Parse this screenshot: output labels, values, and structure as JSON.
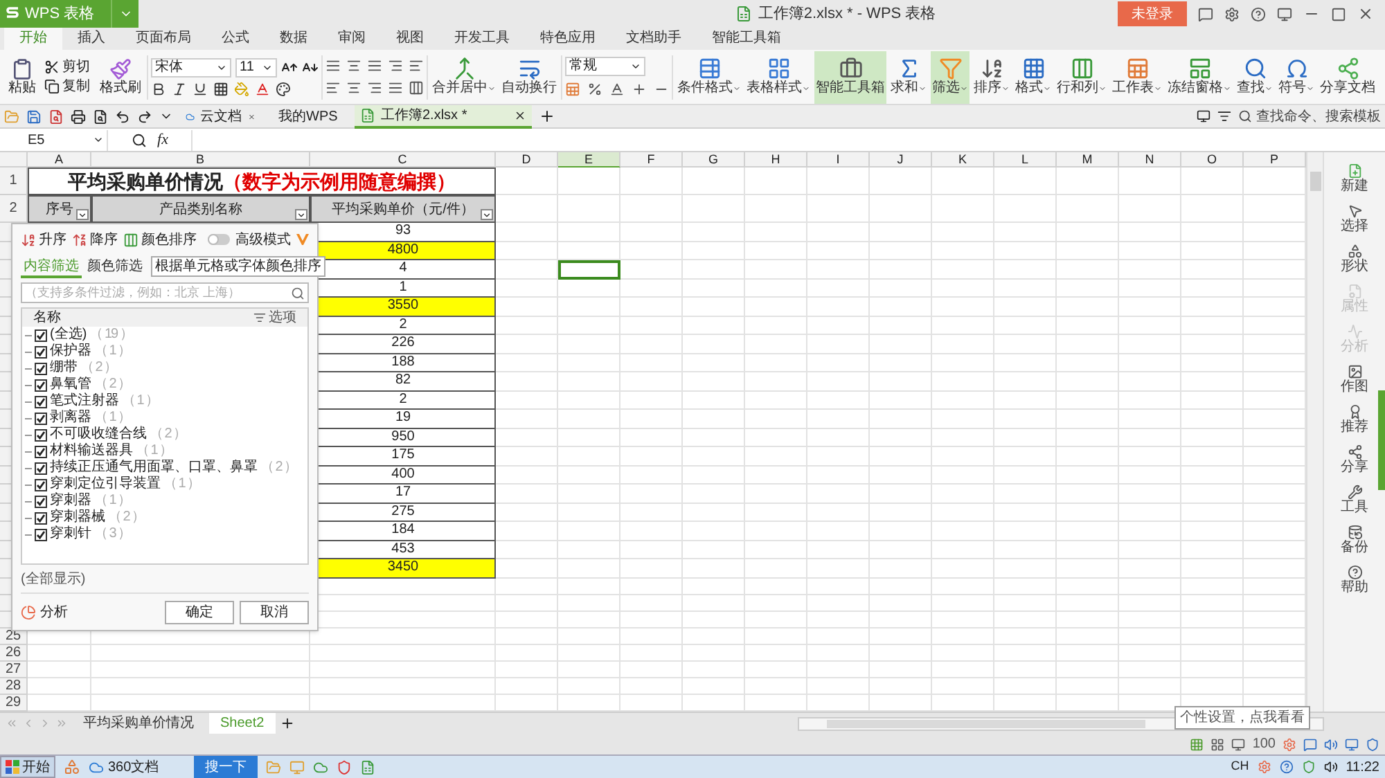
{
  "title_bar": {
    "app_button": "WPS 表格",
    "title": "工作簿2.xlsx * - WPS 表格",
    "login_button": "未登录"
  },
  "menu_tabs": [
    {
      "label": "开始",
      "selected": true
    },
    {
      "label": "插入",
      "selected": false
    },
    {
      "label": "页面布局",
      "selected": false
    },
    {
      "label": "公式",
      "selected": false
    },
    {
      "label": "数据",
      "selected": false
    },
    {
      "label": "审阅",
      "selected": false
    },
    {
      "label": "视图",
      "selected": false
    },
    {
      "label": "开发工具",
      "selected": false
    },
    {
      "label": "特色应用",
      "selected": false
    },
    {
      "label": "文档助手",
      "selected": false
    },
    {
      "label": "智能工具箱",
      "selected": false
    }
  ],
  "ribbon": {
    "paste": "粘贴",
    "cut": "剪切",
    "copy": "复制",
    "format_painter": "格式刷",
    "font_name": "宋体",
    "font_size": "11",
    "number_format": "常规",
    "align_tools": [
      {
        "kind": "merge",
        "label": "合并居中",
        "dropdown": true,
        "highlighted": false
      },
      {
        "kind": "wrap",
        "label": "自动换行",
        "dropdown": false,
        "highlighted": false
      }
    ],
    "tools": [
      {
        "kind": "conditional",
        "label": "条件格式",
        "dropdown": true,
        "highlighted": false
      },
      {
        "kind": "table_style",
        "label": "表格样式",
        "dropdown": true,
        "highlighted": false
      },
      {
        "kind": "toolbox",
        "label": "智能工具箱",
        "dropdown": false,
        "highlighted": true
      },
      {
        "kind": "sum",
        "label": "求和",
        "dropdown": true,
        "highlighted": false
      },
      {
        "kind": "filter",
        "label": "筛选",
        "dropdown": true,
        "highlighted": true
      },
      {
        "kind": "sort",
        "label": "排序",
        "dropdown": true,
        "highlighted": false
      },
      {
        "kind": "format",
        "label": "格式",
        "dropdown": true,
        "highlighted": false
      },
      {
        "kind": "rows_cols",
        "label": "行和列",
        "dropdown": true,
        "highlighted": false
      },
      {
        "kind": "sheet",
        "label": "工作表",
        "dropdown": true,
        "highlighted": false
      },
      {
        "kind": "freeze",
        "label": "冻结窗格",
        "dropdown": true,
        "highlighted": false
      },
      {
        "kind": "find",
        "label": "查找",
        "dropdown": true,
        "highlighted": false
      },
      {
        "kind": "symbol",
        "label": "符号",
        "dropdown": true,
        "highlighted": false
      },
      {
        "kind": "share",
        "label": "分享文档",
        "dropdown": false,
        "highlighted": false
      }
    ]
  },
  "doc_tabs": [
    {
      "kind": "cloud",
      "label": "云文档",
      "selected": false
    },
    {
      "kind": "wps",
      "label": "我的WPS",
      "selected": false
    },
    {
      "kind": "sheet",
      "label": "工作簿2.xlsx *",
      "selected": true
    }
  ],
  "command_search": "查找命令、搜索模板",
  "formula_bar": {
    "name_box": "E5",
    "fx_label": "fx"
  },
  "columns": [
    {
      "label": "A",
      "selected": false
    },
    {
      "label": "B",
      "selected": false
    },
    {
      "label": "C",
      "selected": false
    },
    {
      "label": "D",
      "selected": false
    },
    {
      "label": "E",
      "selected": true
    },
    {
      "label": "F",
      "selected": false
    },
    {
      "label": "G",
      "selected": false
    },
    {
      "label": "H",
      "selected": false
    },
    {
      "label": "I",
      "selected": false
    },
    {
      "label": "J",
      "selected": false
    },
    {
      "label": "K",
      "selected": false
    },
    {
      "label": "L",
      "selected": false
    },
    {
      "label": "M",
      "selected": false
    },
    {
      "label": "N",
      "selected": false
    },
    {
      "label": "O",
      "selected": false
    },
    {
      "label": "P",
      "selected": false
    }
  ],
  "table": {
    "title_row_number": "1",
    "title": "平均采购单价情况",
    "title_note": "（数字为示例用随意编撰）",
    "header_row_number": "2",
    "headers": [
      "序号",
      "产品类别名称",
      "平均采购单价（元/件）"
    ],
    "rows": [
      {
        "value": "93",
        "highlight": false,
        "selected": false
      },
      {
        "value": "4800",
        "highlight": true,
        "selected": false
      },
      {
        "value": "4",
        "highlight": false,
        "selected": true
      },
      {
        "value": "1",
        "highlight": false,
        "selected": false
      },
      {
        "value": "3550",
        "highlight": true,
        "selected": false
      },
      {
        "value": "2",
        "highlight": false,
        "selected": false
      },
      {
        "value": "226",
        "highlight": false,
        "selected": false
      },
      {
        "value": "188",
        "highlight": false,
        "selected": false
      },
      {
        "value": "82",
        "highlight": false,
        "selected": false
      },
      {
        "value": "2",
        "highlight": false,
        "selected": false
      },
      {
        "value": "19",
        "highlight": false,
        "selected": false
      },
      {
        "value": "950",
        "highlight": false,
        "selected": false
      },
      {
        "value": "175",
        "highlight": false,
        "selected": false
      },
      {
        "value": "400",
        "highlight": false,
        "selected": false
      },
      {
        "value": "17",
        "highlight": false,
        "selected": false
      },
      {
        "value": "275",
        "highlight": false,
        "selected": false
      },
      {
        "value": "184",
        "highlight": false,
        "selected": false
      },
      {
        "value": "453",
        "highlight": false,
        "selected": false
      },
      {
        "value": "3450",
        "highlight": true,
        "selected": false
      }
    ],
    "empty_rows": [
      {},
      {},
      {},
      {
        "number": "25"
      },
      {
        "number": "26"
      },
      {
        "number": "27"
      },
      {
        "number": "28"
      },
      {
        "number": "29"
      }
    ]
  },
  "filter_panel": {
    "sort_ascending": "升序",
    "sort_descending": "降序",
    "color_sort": "颜色排序",
    "advanced_mode": {
      "label": "高级模式",
      "on": false
    },
    "tabs": [
      {
        "label": "内容筛选",
        "selected": true
      },
      {
        "label": "颜色筛选",
        "selected": false
      }
    ],
    "color_sort_button": "根据单元格或字体颜色排序",
    "search_placeholder": "（支持多条件过滤，例如：北京 上海）",
    "list_header": "名称",
    "options_button": "选项",
    "items": [
      {
        "label": "(全选)",
        "count": "（ 19 ）",
        "checked": true
      },
      {
        "label": "保护器",
        "count": "（ 1 ）",
        "checked": true
      },
      {
        "label": "绷带",
        "count": "（ 2 ）",
        "checked": true
      },
      {
        "label": "鼻氧管",
        "count": "（ 2 ）",
        "checked": true
      },
      {
        "label": "笔式注射器",
        "count": "（ 1 ）",
        "checked": true
      },
      {
        "label": "剥离器",
        "count": "（ 1 ）",
        "checked": true
      },
      {
        "label": "不可吸收缝合线",
        "count": "（ 2 ）",
        "checked": true
      },
      {
        "label": "材料输送器具",
        "count": "（ 1 ）",
        "checked": true
      },
      {
        "label": "持续正压通气用面罩、口罩、鼻罩",
        "count": "（ 2 ）",
        "checked": true
      },
      {
        "label": "穿刺定位引导装置",
        "count": "（ 1 ）",
        "checked": true
      },
      {
        "label": "穿刺器",
        "count": "（ 1 ）",
        "checked": true
      },
      {
        "label": "穿刺器械",
        "count": "（ 2 ）",
        "checked": true
      },
      {
        "label": "穿刺针",
        "count": "（ 3 ）",
        "checked": true
      }
    ],
    "show_all": "(全部显示)",
    "analyze": "分析",
    "ok_button": "确定",
    "cancel_button": "取消"
  },
  "sidebar": [
    {
      "kind": "new",
      "label": "新建",
      "disabled": false
    },
    {
      "kind": "select",
      "label": "选择",
      "disabled": false
    },
    {
      "kind": "shape",
      "label": "形状",
      "disabled": false
    },
    {
      "kind": "property",
      "label": "属性",
      "disabled": true
    },
    {
      "kind": "analyze",
      "label": "分析",
      "disabled": true
    },
    {
      "kind": "draw",
      "label": "作图",
      "disabled": false
    },
    {
      "kind": "recommend",
      "label": "推荐",
      "disabled": false
    },
    {
      "kind": "share",
      "label": "分享",
      "disabled": false
    },
    {
      "kind": "tools",
      "label": "工具",
      "disabled": false
    },
    {
      "kind": "backup",
      "label": "备份",
      "disabled": false
    },
    {
      "kind": "help",
      "label": "帮助",
      "disabled": false
    }
  ],
  "sheet_tabs": [
    {
      "label": "平均采购单价情况",
      "selected": false
    },
    {
      "label": "Sheet2",
      "selected": true
    }
  ],
  "status_bar": {
    "zoom": "100",
    "tooltip": "个性设置，点我看看"
  },
  "taskbar": {
    "start": "开始",
    "apps": [
      {
        "label": "360文档"
      }
    ],
    "search_button": "搜一下",
    "language": "CH",
    "clock": "11:22"
  }
}
